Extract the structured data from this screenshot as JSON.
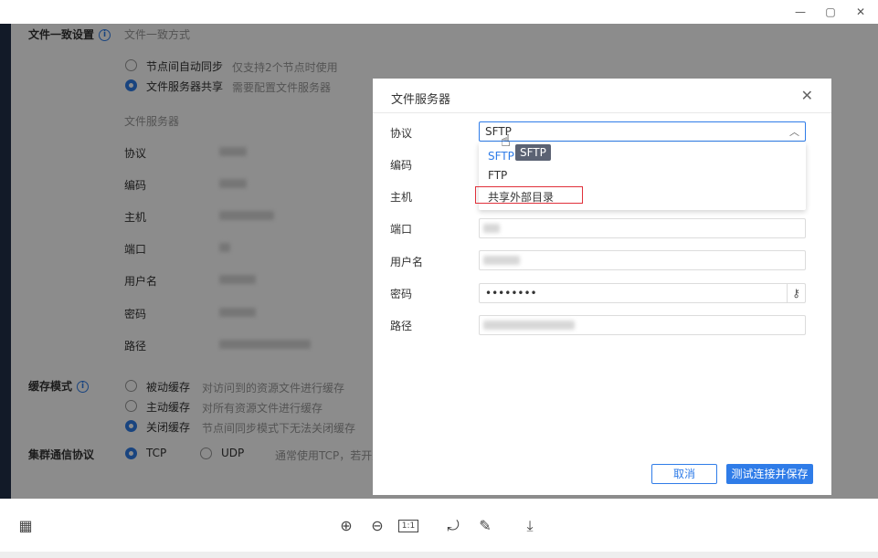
{
  "window": {
    "minimize_icon": "—",
    "maximize_icon": "▢",
    "close_icon": "✕"
  },
  "background": {
    "file_consistency": {
      "label": "文件一致设置",
      "mode_title": "文件一致方式",
      "options": [
        {
          "label": "节点间自动同步",
          "desc": "仅支持2个节点时使用",
          "selected": false
        },
        {
          "label": "文件服务器共享",
          "desc": "需要配置文件服务器",
          "selected": true
        }
      ],
      "server_title": "文件服务器",
      "fields": [
        "协议",
        "编码",
        "主机",
        "端口",
        "用户名",
        "密码",
        "路径"
      ]
    },
    "cache_mode": {
      "label": "缓存模式",
      "options": [
        {
          "label": "被动缓存",
          "desc": "对访问到的资源文件进行缓存",
          "selected": false
        },
        {
          "label": "主动缓存",
          "desc": "对所有资源文件进行缓存",
          "selected": false
        },
        {
          "label": "关闭缓存",
          "desc": "节点间同步模式下无法关闭缓存",
          "selected": true
        }
      ]
    },
    "cluster_protocol": {
      "label": "集群通信协议",
      "options": [
        {
          "label": "TCP",
          "selected": true
        },
        {
          "label": "UDP",
          "selected": false
        }
      ],
      "desc": "通常使用TCP，若开启"
    }
  },
  "modal": {
    "title": "文件服务器",
    "close_icon": "✕",
    "fields": {
      "protocol_label": "协议",
      "protocol_value": "SFTP",
      "encoding_label": "编码",
      "host_label": "主机",
      "port_label": "端口",
      "username_label": "用户名",
      "password_label": "密码",
      "password_value": "••••••••",
      "path_label": "路径"
    },
    "dropdown": {
      "options": [
        "SFTP",
        "FTP",
        "共享外部目录"
      ],
      "selected": "SFTP",
      "tooltip": "SFTP"
    },
    "buttons": {
      "cancel": "取消",
      "save": "测试连接并保存"
    }
  },
  "toolbar": {
    "actual_size_label": "1:1"
  },
  "colors": {
    "accent": "#2f7ce8",
    "highlight_box": "#e0303a",
    "dark_sidebar": "#22304a"
  }
}
